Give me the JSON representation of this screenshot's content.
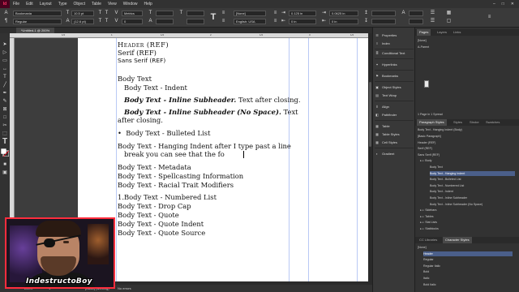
{
  "menubar": {
    "logo": "Id",
    "items": [
      "File",
      "Edit",
      "Layout",
      "Type",
      "Object",
      "Table",
      "View",
      "Window",
      "Help"
    ]
  },
  "control": {
    "font_family": "Bookmania",
    "font_style": "Regular",
    "font_size": "10.5 pt",
    "leading": "(12.6 pt)",
    "kerning": "Metrics",
    "tracking": "0",
    "paragraph_style": "[None]",
    "language": "English: USA",
    "indent_left": "0.125 in",
    "indent_right": "0 in",
    "first_line_indent": "0.0625 in",
    "last_line_indent": "0 in"
  },
  "document": {
    "tab_title": "*Untitled-1 @ 200%"
  },
  "ruler": {
    "ticks": [
      "1/2",
      "1",
      "1/2",
      "2",
      "1/2",
      "3",
      "1/2"
    ]
  },
  "page_text": {
    "header": "Header (REF)",
    "serif": "Serif (REF)",
    "sans": "Sans Serif (REF)",
    "body": "Body Text",
    "indent": "Body Text - Indent",
    "inline_bold": "Body Text - Inline Subheader.",
    "inline_rest": " Text after closing.",
    "inline_ns_bold": "Body Text - Inline Subheader (No Space).",
    "inline_ns_rest": " Text",
    "inline_ns_rest2": "after closing.",
    "bullet": "Body Text - Bulleted List",
    "hanging_1": "Body Text - Hanging Indent after I type past a line",
    "hanging_2": "break you can see that the fo",
    "metadata": "Body Text - Metadata",
    "spellcasting": "Body Text - Spellcasting Information",
    "racial": "Body Text - Racial Trait Modifiers",
    "numbered": "1.Body Text - Numbered List",
    "dropcap": "Body Text - Drop Cap",
    "quote": "Body Text - Quote",
    "quote_indent": "Body Text - Quote Indent",
    "quote_source": "Body Text - Quote Source"
  },
  "status": {
    "zoom": "200%",
    "page": "1",
    "style": "[Basic] (working)",
    "preflight": "No errors"
  },
  "mid_panel": {
    "items": [
      "Properties",
      "Index",
      "Conditional Text",
      "Hyperlinks",
      "Bookmarks",
      "Object Styles",
      "Text Wrap",
      "Align",
      "Pathfinder",
      "Table",
      "Table Styles",
      "Cell Styles",
      "Gradient"
    ]
  },
  "pages_panel": {
    "tabs": [
      "Pages",
      "Layers",
      "Links"
    ],
    "none_item": "[None]",
    "master": "A-Parent",
    "footer": "1 Page in 1 Spread"
  },
  "paragraph_styles": {
    "tabs": [
      "Paragraph Styles",
      "Styles",
      "Stroke",
      "Swatches"
    ],
    "current": "Body Text - Hanging Indent (Body)",
    "items": [
      "[Basic Paragraph]",
      "Header (REF)",
      "Serif (REF)",
      "Sans Serif (REF)",
      "Body",
      "Body Text",
      "Body Text - Hanging Indent",
      "Body Text - Bulleted List",
      "Body Text - Numbered List",
      "Body Text - Indent",
      "Body Text - Inline Subheader",
      "Body Text - Inline Subheader (No Space)",
      "Sidebars",
      "Tables",
      "Stat Lists",
      "Statblocks"
    ],
    "selected_index": 6,
    "folder_indices": [
      4,
      12,
      13,
      14,
      15
    ]
  },
  "character_styles": {
    "tabs": [
      "CC Libraries",
      "Character Styles"
    ],
    "items": [
      "[None]",
      "Header",
      "Regular",
      "Regular Italic",
      "Bold",
      "Italic",
      "Bold Italic"
    ],
    "selected_index": 1
  },
  "webcam": {
    "label": "IndestructoBoy"
  },
  "colors": {
    "accent": "#ff2d3d",
    "selection": "#4b5f8a"
  }
}
